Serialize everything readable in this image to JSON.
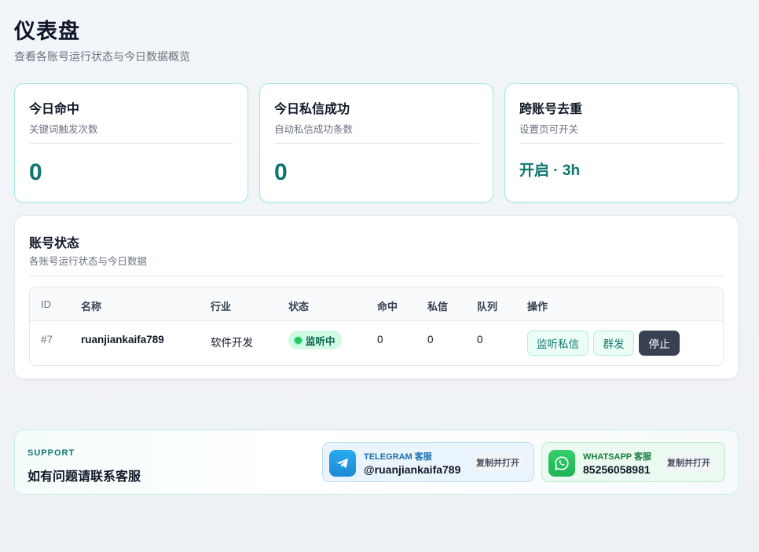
{
  "page": {
    "title": "仪表盘",
    "subtitle": "查看各账号运行状态与今日数据概览"
  },
  "stats": [
    {
      "title": "今日命中",
      "desc": "关键词触发次数",
      "value": "0"
    },
    {
      "title": "今日私信成功",
      "desc": "自动私信成功条数",
      "value": "0"
    },
    {
      "title": "跨账号去重",
      "desc": "设置页可开关",
      "value": "开启 · 3h"
    }
  ],
  "accounts": {
    "title": "账号状态",
    "desc": "各账号运行状态与今日数据",
    "columns": {
      "id": "ID",
      "name": "名称",
      "industry": "行业",
      "status": "状态",
      "hits": "命中",
      "dms": "私信",
      "queue": "队列",
      "actions": "操作"
    },
    "rows": [
      {
        "id": "#7",
        "name": "ruanjiankaifa789",
        "industry": "软件开发",
        "status": "监听中",
        "hits": "0",
        "dms": "0",
        "queue": "0",
        "actions": {
          "listen_dm": "监听私信",
          "broadcast": "群发",
          "stop": "停止"
        }
      }
    ]
  },
  "support": {
    "eyebrow": "SUPPORT",
    "heading": "如有问题请联系客服",
    "telegram": {
      "label": "TELEGRAM 客服",
      "handle": "@ruanjiankaifa789",
      "copy": "复制并打开",
      "icon": "telegram-icon"
    },
    "whatsapp": {
      "label": "WHATSAPP 客服",
      "handle": "85256058981",
      "copy": "复制并打开",
      "icon": "whatsapp-icon"
    }
  },
  "colors": {
    "accent": "#0f766e",
    "status_dot": "#22c55e",
    "stop_button": "#374151"
  }
}
